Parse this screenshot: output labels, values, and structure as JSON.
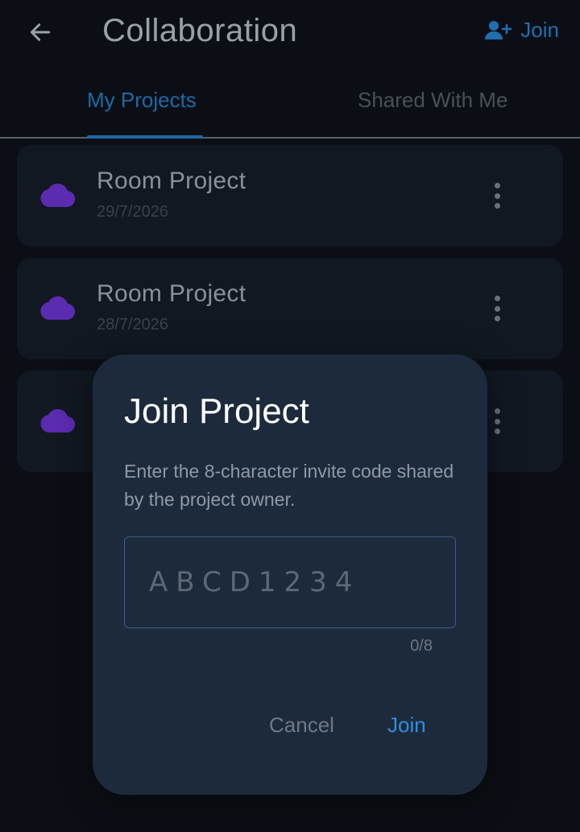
{
  "appbar": {
    "title": "Collaboration",
    "join_label": "Join",
    "back_icon": "arrow-left-icon",
    "join_icon": "person-add-icon"
  },
  "tabs": [
    {
      "label": "My Projects",
      "active": true
    },
    {
      "label": "Shared With Me",
      "active": false
    }
  ],
  "projects": [
    {
      "name": "Room Project",
      "date": "29/7/2026",
      "icon": "cloud-icon"
    },
    {
      "name": "Room Project",
      "date": "28/7/2026",
      "icon": "cloud-icon"
    },
    {
      "name": "",
      "date": "",
      "icon": "cloud-icon"
    }
  ],
  "dialog": {
    "title": "Join Project",
    "message": "Enter the 8-character invite code shared by the project owner.",
    "input_placeholder": "ABCD1234",
    "input_value": "",
    "counter": "0/8",
    "cancel_label": "Cancel",
    "join_label": "Join"
  },
  "colors": {
    "background": "#0b0f15",
    "card": "#111821",
    "dialog": "#1c2a3b",
    "accent": "#2f8ee0",
    "cloud": "#5b2bb0"
  }
}
